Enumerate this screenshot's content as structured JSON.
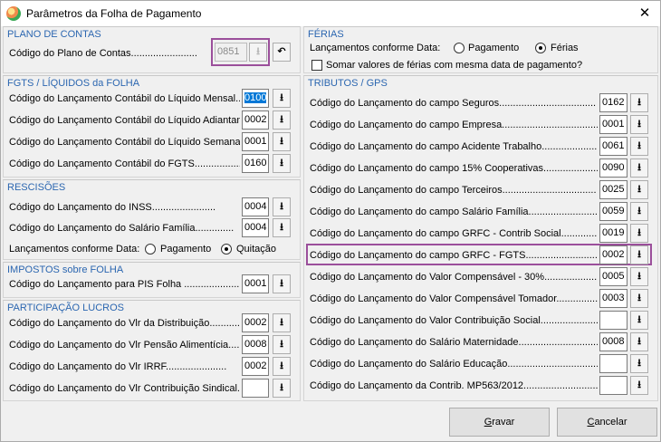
{
  "window": {
    "title": "Parâmetros da Folha de Pagamento",
    "close_glyph": "✕"
  },
  "plano": {
    "title": "PLANO DE CONTAS",
    "label": "Código do Plano de Contas........................",
    "value": "0851"
  },
  "fgts": {
    "title": "FGTS / LÍQUIDOS da FOLHA",
    "rows": [
      {
        "label": "Código do Lançamento Contábil do Líquido Mensal.....",
        "value": "0100"
      },
      {
        "label": "Código do Lançamento Contábil do Líquido Adiantamento",
        "value": "0002"
      },
      {
        "label": "Código do Lançamento Contábil do Líquido Semanal.....",
        "value": "0001"
      },
      {
        "label": "Código do Lançamento Contábil do FGTS...................",
        "value": "0160"
      }
    ]
  },
  "rescisoes": {
    "title": "RESCISÕES",
    "rows": [
      {
        "label": "Código do Lançamento do INSS.......................",
        "value": "0004"
      },
      {
        "label": "Código do Lançamento do Salário Família..............",
        "value": "0004"
      }
    ],
    "data_label": "Lançamentos conforme Data:",
    "option_pagamento": "Pagamento",
    "option_quitacao": "Quitação"
  },
  "impostos": {
    "title": "IMPOSTOS sobre FOLHA",
    "label": "Código do Lançamento para PIS Folha ........................",
    "value": "0001"
  },
  "participacao": {
    "title": "PARTICIPAÇÃO  LUCROS",
    "rows": [
      {
        "label": "Código do Lançamento do Vlr da Distribuição.............",
        "value": "0002"
      },
      {
        "label": "Código do Lançamento do Vlr Pensão Alimentícia...........",
        "value": "0008"
      },
      {
        "label": "Código do Lançamento do Vlr IRRF......................",
        "value": "0002"
      },
      {
        "label": "Código do Lançamento do Vlr Contribuição Sindical.......",
        "value": ""
      }
    ]
  },
  "ferias": {
    "title": "FÉRIAS",
    "data_label": "Lançamentos conforme Data:",
    "option_pagamento": "Pagamento",
    "option_ferias": "Férias",
    "somar_label": "Somar valores de férias com mesma data de pagamento?"
  },
  "tributos": {
    "title": "TRIBUTOS  /  GPS",
    "rows": [
      {
        "label": "Código do Lançamento do campo Seguros...................................",
        "value": "0162"
      },
      {
        "label": "Código do Lançamento do campo Empresa....................................",
        "value": "0001"
      },
      {
        "label": "Código do Lançamento do campo Acidente Trabalho.............................",
        "value": "0061"
      },
      {
        "label": "Código do Lançamento do campo 15% Cooperativas..............................",
        "value": "0090"
      },
      {
        "label": "Código do Lançamento do campo Terceiros..................................",
        "value": "0025"
      },
      {
        "label": "Código do Lançamento do campo Salário Família.............................",
        "value": "0059"
      },
      {
        "label": "Código do Lançamento do campo GRFC - Contrib Social.......................",
        "value": "0019"
      },
      {
        "label": "Código do Lançamento do campo GRFC - FGTS................................",
        "value": "0002"
      },
      {
        "label": "Código do Lançamento do Valor Compensável - 30%..........................",
        "value": "0005"
      },
      {
        "label": "Código do Lançamento do Valor Compensável Tomador........................",
        "value": "0003"
      },
      {
        "label": "Código do Lançamento do Valor Contribuição Social.........................",
        "value": ""
      },
      {
        "label": "Código do Lançamento do Salário Maternidade..............................",
        "value": "0008"
      },
      {
        "label": "Código do Lançamento do Salário Educação..................................",
        "value": ""
      },
      {
        "label": "Código do Lançamento da Contrib. MP563/2012...............................",
        "value": ""
      }
    ]
  },
  "buttons": {
    "gravar": "Gravar",
    "cancelar": "Cancelar"
  },
  "icons": {
    "download": "⭳",
    "undo": "↶"
  }
}
